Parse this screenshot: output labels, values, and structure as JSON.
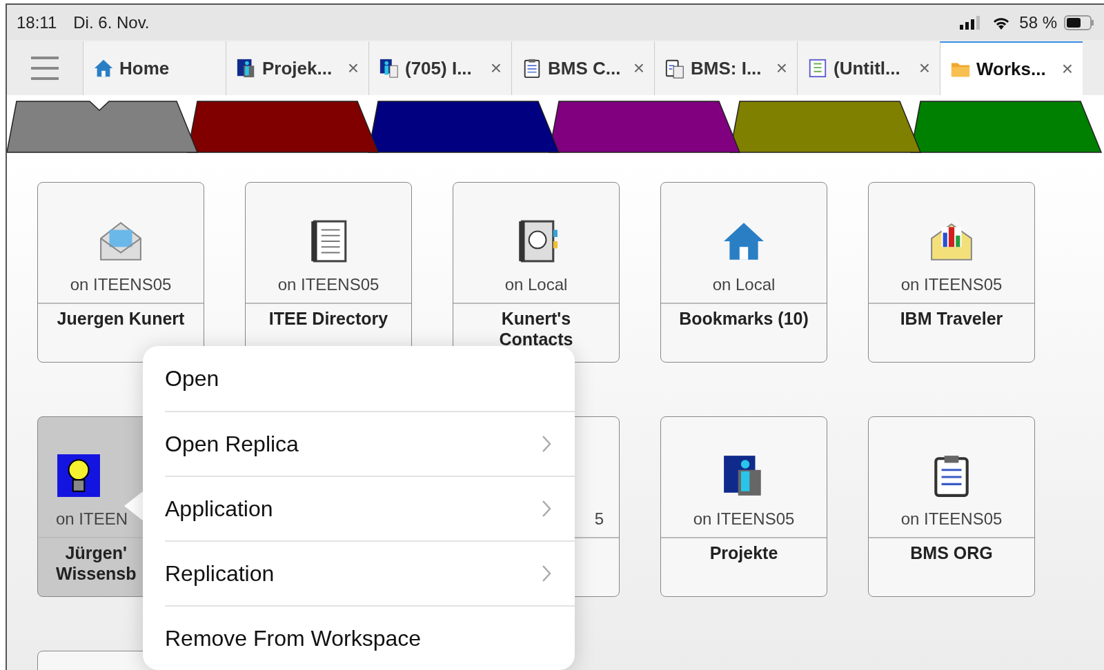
{
  "status_bar": {
    "time": "18:11",
    "date": "Di. 6. Nov.",
    "battery": "58 %"
  },
  "tabs": [
    {
      "kind": "home",
      "label": "Home",
      "closable": false,
      "selected": false
    },
    {
      "kind": "info",
      "label": "Projek...",
      "closable": true,
      "selected": false
    },
    {
      "kind": "info-doc",
      "label": "(705) I...",
      "closable": true,
      "selected": false
    },
    {
      "kind": "clipboard",
      "label": "BMS C...",
      "closable": true,
      "selected": false
    },
    {
      "kind": "clipboard-doc",
      "label": "BMS: I...",
      "closable": true,
      "selected": false
    },
    {
      "kind": "itee",
      "label": "(Untitl...",
      "closable": true,
      "selected": false
    },
    {
      "kind": "folder",
      "label": "Works...",
      "closable": true,
      "selected": true
    }
  ],
  "close_glyph": "×",
  "color_tabs": [
    {
      "color": "#808080",
      "selected": true
    },
    {
      "color": "#800000",
      "selected": false
    },
    {
      "color": "#000080",
      "selected": false
    },
    {
      "color": "#800080",
      "selected": false
    },
    {
      "color": "#808000",
      "selected": false
    },
    {
      "color": "#008000",
      "selected": false
    }
  ],
  "tile_rows": [
    [
      {
        "kind": "mail",
        "location": "on ITEENS05",
        "title": [
          "Juergen Kunert"
        ],
        "selected": false
      },
      {
        "kind": "directory",
        "location": "on ITEENS05",
        "title": [
          "ITEE Directory"
        ],
        "selected": false
      },
      {
        "kind": "address-book",
        "location": "on Local",
        "title": [
          "Kunert's",
          "Contacts"
        ],
        "selected": false
      },
      {
        "kind": "home",
        "location": "on Local",
        "title": [
          "Bookmarks (10)"
        ],
        "selected": false
      },
      {
        "kind": "traveler",
        "location": "on ITEENS05",
        "title": [
          "IBM Traveler"
        ],
        "selected": false
      }
    ],
    [
      {
        "kind": "lightbulb",
        "location": "on ITEEN",
        "title": [
          "Jürgen'",
          "Wissensb"
        ],
        "selected": true,
        "covered": true
      },
      null,
      {
        "location": "5",
        "selected": false,
        "covered": true
      },
      {
        "kind": "info",
        "location": "on ITEENS05",
        "title": [
          "Projekte"
        ],
        "selected": false
      },
      {
        "kind": "clipboard",
        "location": "on ITEENS05",
        "title": [
          "BMS ORG"
        ],
        "selected": false
      }
    ],
    [
      {
        "selected": false
      }
    ]
  ],
  "context_menu": [
    {
      "label": "Open",
      "submenu": false
    },
    {
      "label": "Open Replica",
      "submenu": true
    },
    {
      "label": "Application",
      "submenu": true
    },
    {
      "label": "Replication",
      "submenu": true
    },
    {
      "label": "Remove From Workspace",
      "submenu": false
    }
  ]
}
